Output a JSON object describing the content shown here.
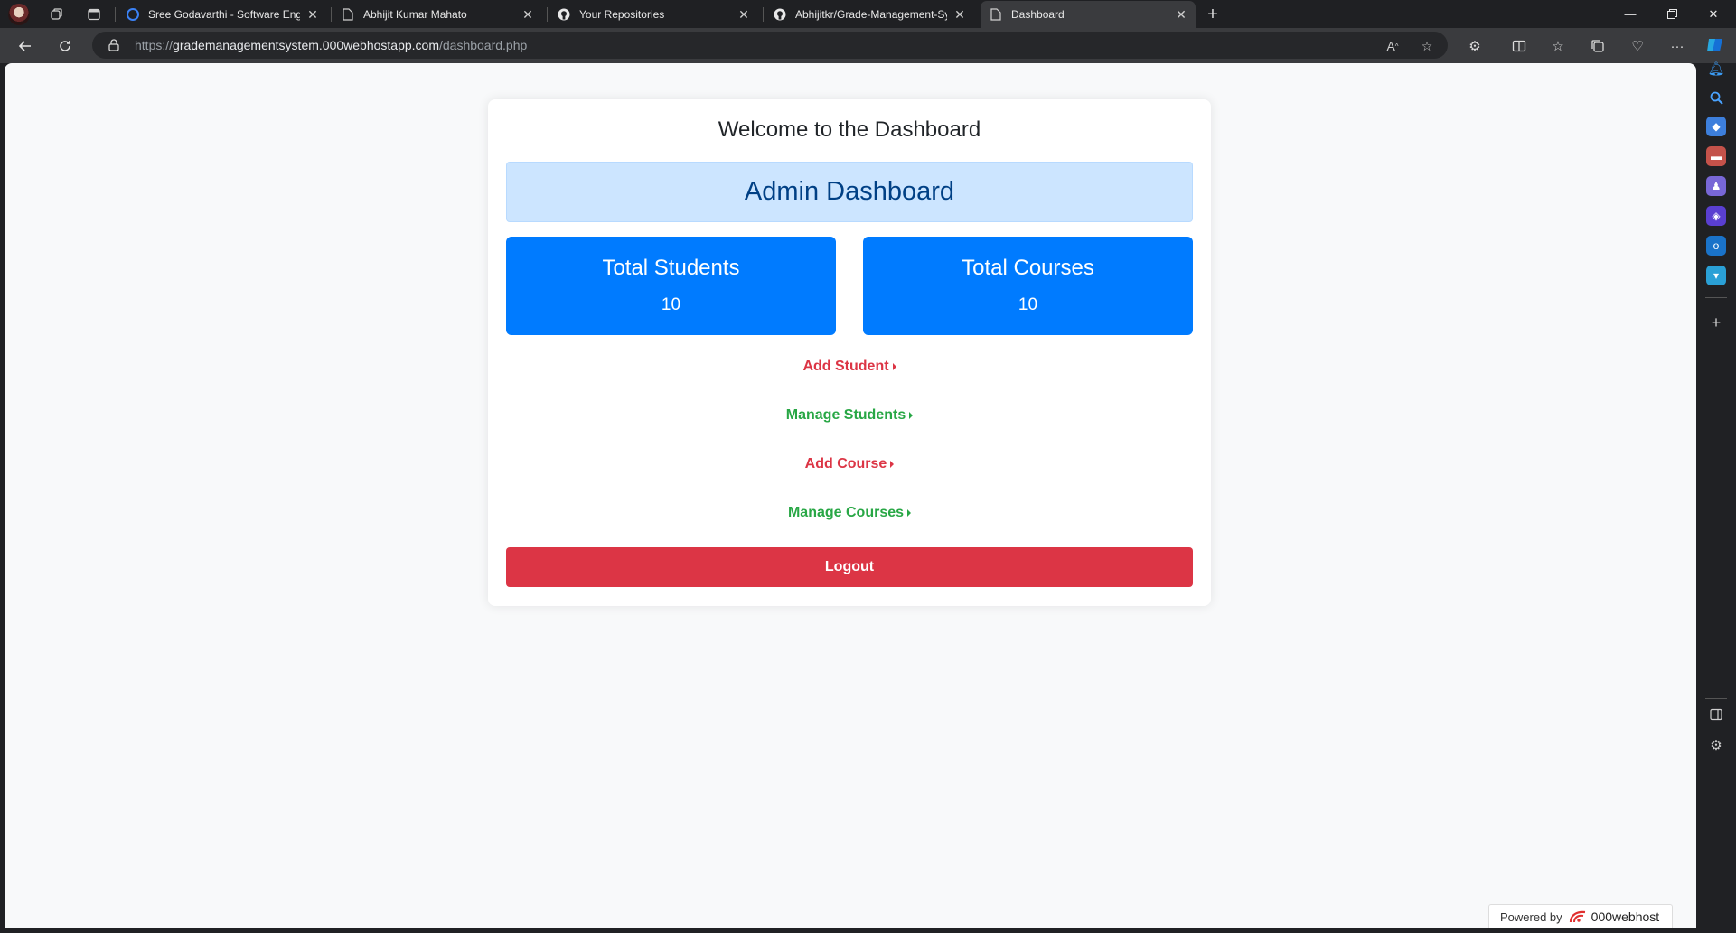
{
  "browser": {
    "tabs": [
      {
        "title": "Sree Godavarthi - Software Engi",
        "favicon": "edge-profile-icon",
        "active": false
      },
      {
        "title": "Abhijit Kumar Mahato",
        "favicon": "page-icon",
        "active": false
      },
      {
        "title": "Your Repositories",
        "favicon": "github-icon",
        "active": false
      },
      {
        "title": "Abhijitkr/Grade-Management-Sy",
        "favicon": "github-icon",
        "active": false
      },
      {
        "title": "Dashboard",
        "favicon": "page-icon",
        "active": true
      }
    ],
    "address": {
      "scheme": "https://",
      "host": "grademanagementsystem.000webhostapp.com",
      "path": "/dashboard.php"
    }
  },
  "page": {
    "heading": "Welcome to the Dashboard",
    "banner": "Admin Dashboard",
    "stats": [
      {
        "label": "Total Students",
        "value": "10"
      },
      {
        "label": "Total Courses",
        "value": "10"
      }
    ],
    "links": [
      {
        "label": "Add Student",
        "color": "#dc3545"
      },
      {
        "label": "Manage Students",
        "color": "#28a745"
      },
      {
        "label": "Add Course",
        "color": "#dc3545"
      },
      {
        "label": "Manage Courses",
        "color": "#28a745"
      }
    ],
    "logout": "Logout"
  },
  "footer": {
    "powered_by": "Powered by",
    "brand": "000webhost"
  },
  "colors": {
    "primary": "#007bff",
    "danger": "#dc3545",
    "success": "#28a745",
    "banner_bg": "#cce5ff",
    "banner_text": "#004085"
  }
}
